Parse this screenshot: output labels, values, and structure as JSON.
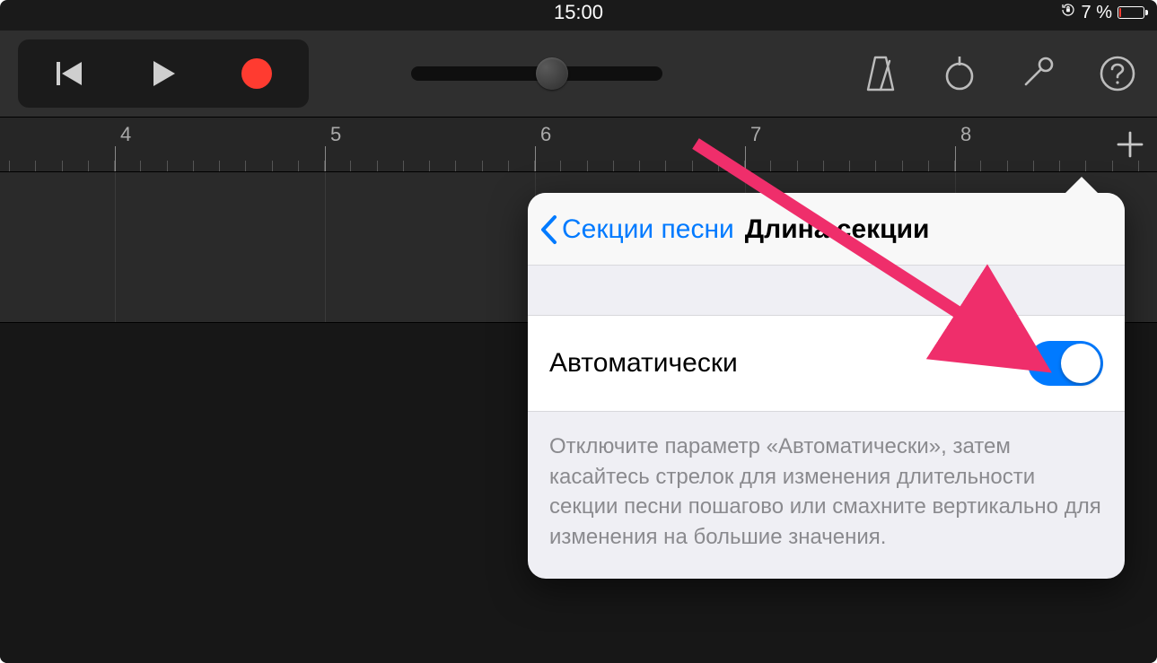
{
  "status": {
    "time": "15:00",
    "battery_text": "7 %",
    "battery_level_pct": 7
  },
  "ruler": {
    "numbers": [
      "4",
      "5",
      "6",
      "7",
      "8"
    ]
  },
  "popover": {
    "back_label": "Секции песни",
    "title": "Длина секции",
    "auto_label": "Автоматически",
    "auto_on": true,
    "hint": "Отключите параметр «Автоматически», затем касайтесь стрелок для изменения длительности секции песни пошагово или смахните вертикально для изменения на большие значения."
  },
  "colors": {
    "accent": "#007aff",
    "record": "#ff3b30",
    "arrow": "#ef2e6b"
  }
}
